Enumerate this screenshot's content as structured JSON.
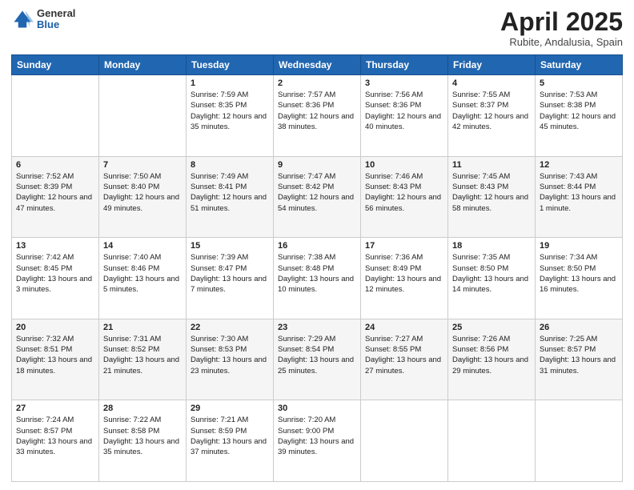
{
  "header": {
    "logo_general": "General",
    "logo_blue": "Blue",
    "title": "April 2025",
    "location": "Rubite, Andalusia, Spain"
  },
  "weekdays": [
    "Sunday",
    "Monday",
    "Tuesday",
    "Wednesday",
    "Thursday",
    "Friday",
    "Saturday"
  ],
  "weeks": [
    [
      {
        "day": "",
        "sunrise": "",
        "sunset": "",
        "daylight": ""
      },
      {
        "day": "",
        "sunrise": "",
        "sunset": "",
        "daylight": ""
      },
      {
        "day": "1",
        "sunrise": "Sunrise: 7:59 AM",
        "sunset": "Sunset: 8:35 PM",
        "daylight": "Daylight: 12 hours and 35 minutes."
      },
      {
        "day": "2",
        "sunrise": "Sunrise: 7:57 AM",
        "sunset": "Sunset: 8:36 PM",
        "daylight": "Daylight: 12 hours and 38 minutes."
      },
      {
        "day": "3",
        "sunrise": "Sunrise: 7:56 AM",
        "sunset": "Sunset: 8:36 PM",
        "daylight": "Daylight: 12 hours and 40 minutes."
      },
      {
        "day": "4",
        "sunrise": "Sunrise: 7:55 AM",
        "sunset": "Sunset: 8:37 PM",
        "daylight": "Daylight: 12 hours and 42 minutes."
      },
      {
        "day": "5",
        "sunrise": "Sunrise: 7:53 AM",
        "sunset": "Sunset: 8:38 PM",
        "daylight": "Daylight: 12 hours and 45 minutes."
      }
    ],
    [
      {
        "day": "6",
        "sunrise": "Sunrise: 7:52 AM",
        "sunset": "Sunset: 8:39 PM",
        "daylight": "Daylight: 12 hours and 47 minutes."
      },
      {
        "day": "7",
        "sunrise": "Sunrise: 7:50 AM",
        "sunset": "Sunset: 8:40 PM",
        "daylight": "Daylight: 12 hours and 49 minutes."
      },
      {
        "day": "8",
        "sunrise": "Sunrise: 7:49 AM",
        "sunset": "Sunset: 8:41 PM",
        "daylight": "Daylight: 12 hours and 51 minutes."
      },
      {
        "day": "9",
        "sunrise": "Sunrise: 7:47 AM",
        "sunset": "Sunset: 8:42 PM",
        "daylight": "Daylight: 12 hours and 54 minutes."
      },
      {
        "day": "10",
        "sunrise": "Sunrise: 7:46 AM",
        "sunset": "Sunset: 8:43 PM",
        "daylight": "Daylight: 12 hours and 56 minutes."
      },
      {
        "day": "11",
        "sunrise": "Sunrise: 7:45 AM",
        "sunset": "Sunset: 8:43 PM",
        "daylight": "Daylight: 12 hours and 58 minutes."
      },
      {
        "day": "12",
        "sunrise": "Sunrise: 7:43 AM",
        "sunset": "Sunset: 8:44 PM",
        "daylight": "Daylight: 13 hours and 1 minute."
      }
    ],
    [
      {
        "day": "13",
        "sunrise": "Sunrise: 7:42 AM",
        "sunset": "Sunset: 8:45 PM",
        "daylight": "Daylight: 13 hours and 3 minutes."
      },
      {
        "day": "14",
        "sunrise": "Sunrise: 7:40 AM",
        "sunset": "Sunset: 8:46 PM",
        "daylight": "Daylight: 13 hours and 5 minutes."
      },
      {
        "day": "15",
        "sunrise": "Sunrise: 7:39 AM",
        "sunset": "Sunset: 8:47 PM",
        "daylight": "Daylight: 13 hours and 7 minutes."
      },
      {
        "day": "16",
        "sunrise": "Sunrise: 7:38 AM",
        "sunset": "Sunset: 8:48 PM",
        "daylight": "Daylight: 13 hours and 10 minutes."
      },
      {
        "day": "17",
        "sunrise": "Sunrise: 7:36 AM",
        "sunset": "Sunset: 8:49 PM",
        "daylight": "Daylight: 13 hours and 12 minutes."
      },
      {
        "day": "18",
        "sunrise": "Sunrise: 7:35 AM",
        "sunset": "Sunset: 8:50 PM",
        "daylight": "Daylight: 13 hours and 14 minutes."
      },
      {
        "day": "19",
        "sunrise": "Sunrise: 7:34 AM",
        "sunset": "Sunset: 8:50 PM",
        "daylight": "Daylight: 13 hours and 16 minutes."
      }
    ],
    [
      {
        "day": "20",
        "sunrise": "Sunrise: 7:32 AM",
        "sunset": "Sunset: 8:51 PM",
        "daylight": "Daylight: 13 hours and 18 minutes."
      },
      {
        "day": "21",
        "sunrise": "Sunrise: 7:31 AM",
        "sunset": "Sunset: 8:52 PM",
        "daylight": "Daylight: 13 hours and 21 minutes."
      },
      {
        "day": "22",
        "sunrise": "Sunrise: 7:30 AM",
        "sunset": "Sunset: 8:53 PM",
        "daylight": "Daylight: 13 hours and 23 minutes."
      },
      {
        "day": "23",
        "sunrise": "Sunrise: 7:29 AM",
        "sunset": "Sunset: 8:54 PM",
        "daylight": "Daylight: 13 hours and 25 minutes."
      },
      {
        "day": "24",
        "sunrise": "Sunrise: 7:27 AM",
        "sunset": "Sunset: 8:55 PM",
        "daylight": "Daylight: 13 hours and 27 minutes."
      },
      {
        "day": "25",
        "sunrise": "Sunrise: 7:26 AM",
        "sunset": "Sunset: 8:56 PM",
        "daylight": "Daylight: 13 hours and 29 minutes."
      },
      {
        "day": "26",
        "sunrise": "Sunrise: 7:25 AM",
        "sunset": "Sunset: 8:57 PM",
        "daylight": "Daylight: 13 hours and 31 minutes."
      }
    ],
    [
      {
        "day": "27",
        "sunrise": "Sunrise: 7:24 AM",
        "sunset": "Sunset: 8:57 PM",
        "daylight": "Daylight: 13 hours and 33 minutes."
      },
      {
        "day": "28",
        "sunrise": "Sunrise: 7:22 AM",
        "sunset": "Sunset: 8:58 PM",
        "daylight": "Daylight: 13 hours and 35 minutes."
      },
      {
        "day": "29",
        "sunrise": "Sunrise: 7:21 AM",
        "sunset": "Sunset: 8:59 PM",
        "daylight": "Daylight: 13 hours and 37 minutes."
      },
      {
        "day": "30",
        "sunrise": "Sunrise: 7:20 AM",
        "sunset": "Sunset: 9:00 PM",
        "daylight": "Daylight: 13 hours and 39 minutes."
      },
      {
        "day": "",
        "sunrise": "",
        "sunset": "",
        "daylight": ""
      },
      {
        "day": "",
        "sunrise": "",
        "sunset": "",
        "daylight": ""
      },
      {
        "day": "",
        "sunrise": "",
        "sunset": "",
        "daylight": ""
      }
    ]
  ]
}
